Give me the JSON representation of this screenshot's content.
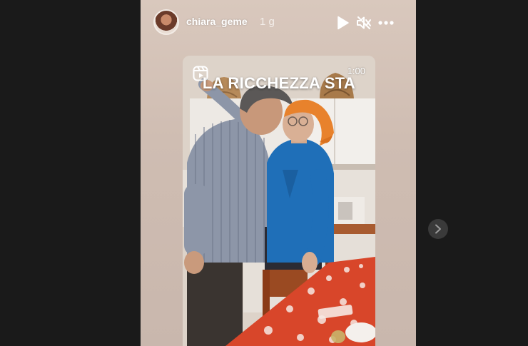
{
  "story": {
    "username": "chiara_geme",
    "time_ago": "1 g",
    "controls": {
      "play_icon": "play-icon",
      "mute_icon": "speaker-muted-icon",
      "more_icon": "more-horizontal-icon"
    }
  },
  "video": {
    "caption": "LA RICCHEZZA STA",
    "duration": "1:00",
    "reel_icon": "reels-icon"
  },
  "navigation": {
    "next_icon": "chevron-right-icon"
  },
  "colors": {
    "page_background": "#1a1a1a",
    "story_background": "#d9c8bd",
    "tablecloth": "#d8462a",
    "scarf": "#e8822c",
    "shirt_blue": "#1f6fb8"
  }
}
